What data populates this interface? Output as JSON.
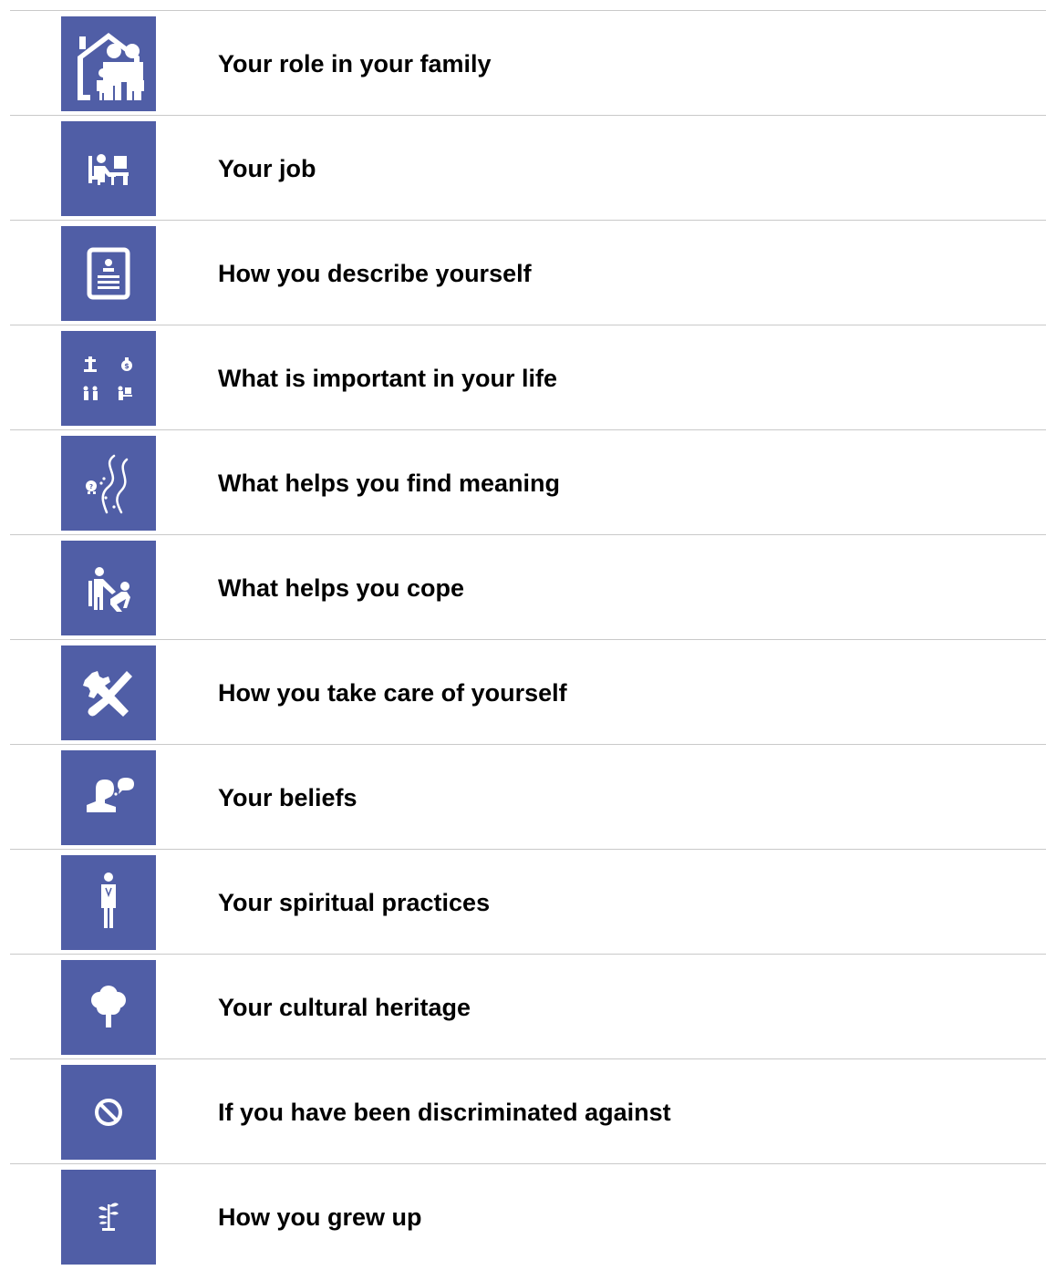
{
  "colors": {
    "tile_background": "#505ea6",
    "icon_foreground": "#ffffff",
    "divider": "#c9c9c9",
    "text": "#000000"
  },
  "items": [
    {
      "icon": "family-house-icon",
      "label": "Your role in your family"
    },
    {
      "icon": "desk-worker-icon",
      "label": "Your job"
    },
    {
      "icon": "profile-card-icon",
      "label": "How you describe yourself"
    },
    {
      "icon": "priorities-grid-icon",
      "label": "What is important in your life"
    },
    {
      "icon": "winding-road-icon",
      "label": "What helps you find meaning"
    },
    {
      "icon": "helping-person-icon",
      "label": "What helps you cope"
    },
    {
      "icon": "wrench-screwdriver-icon",
      "label": "How you take care of yourself"
    },
    {
      "icon": "thinking-person-icon",
      "label": "Your beliefs"
    },
    {
      "icon": "praying-person-icon",
      "label": "Your spiritual practices"
    },
    {
      "icon": "tree-icon",
      "label": "Your cultural heritage"
    },
    {
      "icon": "prohibited-icon",
      "label": "If you have been discriminated against"
    },
    {
      "icon": "sprout-icon",
      "label": "How you grew up"
    }
  ]
}
